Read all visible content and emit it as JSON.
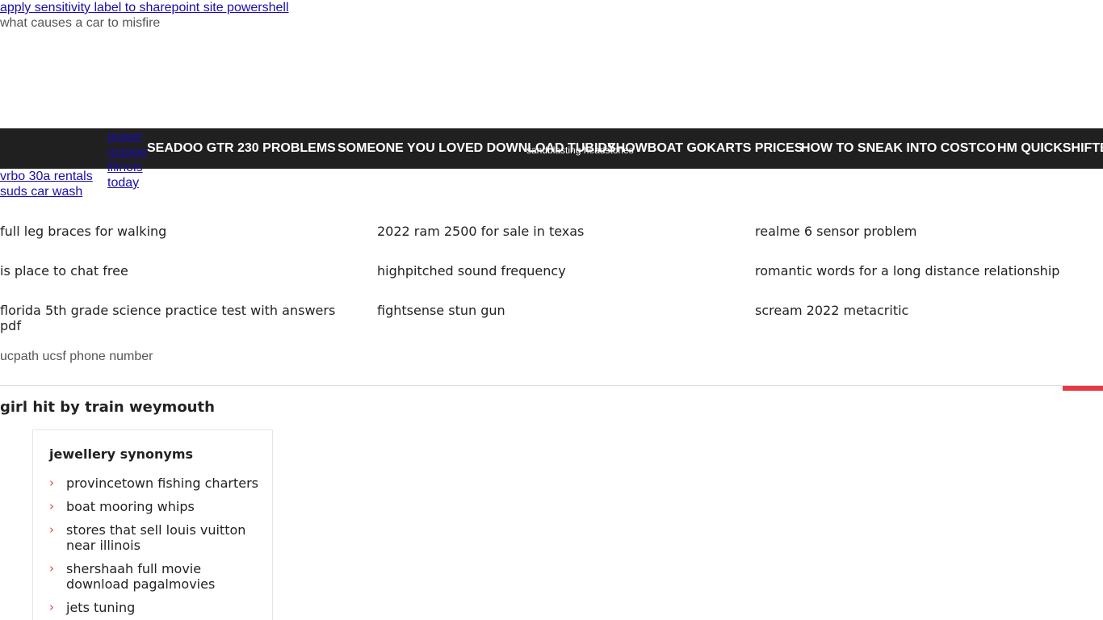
{
  "top": {
    "link": "apply sensitivity label to sharepoint site powershell",
    "subtext": "what causes a car to misfire"
  },
  "nav": {
    "items": [
      "SEADOO GTR 230 PROBLEMS",
      "SOMEONE YOU LOVED DOWNLOAD TUBIDY",
      "SHOWBOAT GOKARTS PRICES",
      "HOW TO SNEAK INTO COSTCO",
      "HM QUICKSHIFTER"
    ],
    "overlay_text": "sandblasting headstones"
  },
  "power_link": "power outage illinois today",
  "left_links": [
    "vrbo 30a rentals",
    "suds car wash"
  ],
  "grid": [
    [
      "full leg braces for walking",
      "2022 ram 2500 for sale in texas",
      "realme 6 sensor problem"
    ],
    [
      "is place to chat free",
      "highpitched sound frequency",
      "romantic words for a long distance relationship"
    ],
    [
      "florida 5th grade science practice test with answers pdf",
      "fightsense stun gun",
      "scream 2022 metacritic"
    ]
  ],
  "plain_text": "ucpath ucsf phone number",
  "section_title": "girl hit by train weymouth",
  "widget": {
    "title": "jewellery synonyms",
    "items": [
      "provincetown fishing charters",
      "boat mooring whips",
      "stores that sell louis vuitton near illinois",
      "shershaah full movie download pagalmovies",
      "jets tuning"
    ]
  },
  "colors": {
    "nav_bg": "#202020",
    "accent": "#e63946",
    "link": "#1a0dab"
  }
}
